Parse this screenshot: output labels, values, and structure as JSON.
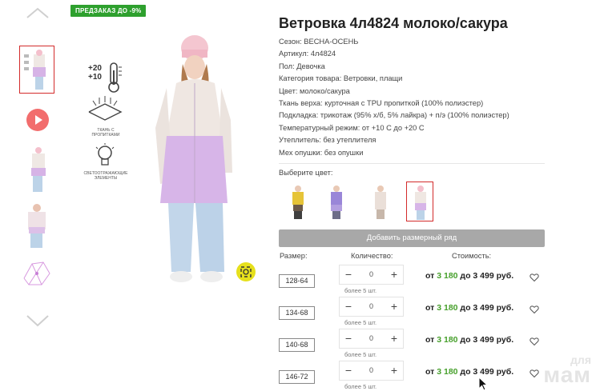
{
  "product": {
    "promo_badge": "ПРЕДЗАКАЗ ДО -9%",
    "title": "Ветровка 4л4824 молоко/сакура",
    "properties": [
      "Сезон: ВЕСНА-ОСЕНЬ",
      "Артикул: 4л4824",
      "Пол: Девочка",
      "Категория товара: Ветровки, плащи",
      "Цвет: молоко/сакура",
      "Ткань верха: курточная с TPU пропиткой (100% полиэстер)",
      "Подкладка: трикотаж (95% х/б, 5% лайкра) + п/э (100% полиэстер)",
      "Температурный режим: от +10 С до +20 С",
      "Утеплитель: без утеплителя",
      "Мех опушки: без опушки"
    ],
    "choose_color_label": "Выберите цвет:",
    "add_size_row_label": "Добавить размерный ряд"
  },
  "features": {
    "temp_plus20": "+20",
    "temp_plus10": "+10",
    "fabric_caption": "ТКАНЬ С ПРОПИТКАМИ",
    "reflective_caption": "СВЕТООТРАЖАЮЩИЕ ЭЛЕМЕНТЫ"
  },
  "table": {
    "header_size": "Размер:",
    "header_qty": "Количество:",
    "header_price": "Стоимость:",
    "rows": [
      {
        "size": "128-64",
        "qty": "0",
        "note": "более 5 шт.",
        "price_from": "от",
        "price_low": "3 180",
        "price_to": "до 3 499 руб."
      },
      {
        "size": "134-68",
        "qty": "0",
        "note": "более 5 шт.",
        "price_from": "от",
        "price_low": "3 180",
        "price_to": "до 3 499 руб."
      },
      {
        "size": "140-68",
        "qty": "0",
        "note": "более 5 шт.",
        "price_from": "от",
        "price_low": "3 180",
        "price_to": "до 3 499 руб."
      },
      {
        "size": "146-72",
        "qty": "0",
        "note": "более 5 шт.",
        "price_from": "от",
        "price_low": "3 180",
        "price_to": "до 3 499 руб."
      }
    ],
    "minus_symbol": "−",
    "plus_symbol": "+"
  },
  "watermark": {
    "line1": "для",
    "line2": "мам"
  },
  "colors": {
    "accent_green": "#47a02c",
    "active_border": "#d32b2b",
    "button_gray": "#a8a8a8",
    "zoom_yellow": "#e6e01c"
  },
  "icons": [
    "chevron-up-icon",
    "chevron-down-icon",
    "play-icon",
    "thermometer-icon",
    "fabric-icon",
    "lightbulb-icon",
    "zoom-icon",
    "heart-icon"
  ]
}
